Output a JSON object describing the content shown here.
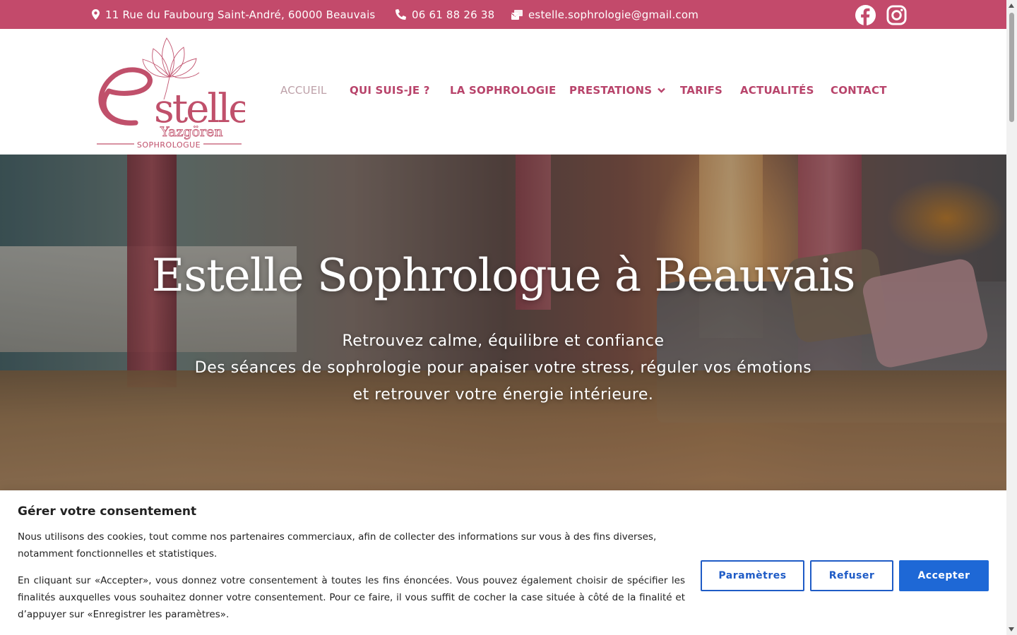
{
  "topbar": {
    "address": "11 Rue du Faubourg Saint-André, 60000 Beauvais",
    "phone": "06 61 88 26 38",
    "email": "estelle.sophrologie@gmail.com",
    "background": "#c34a6b"
  },
  "logo": {
    "name": "Estelle",
    "surname": "Yazgören",
    "tagline": "SOPHROLOGUE"
  },
  "nav": {
    "items": [
      {
        "label": "ACCUEIL",
        "active": true
      },
      {
        "label": "QUI SUIS-JE ?"
      },
      {
        "label": "LA SOPHROLOGIE"
      },
      {
        "label": "PRESTATIONS",
        "has_dropdown": true
      },
      {
        "label": "TARIFS"
      },
      {
        "label": "ACTUALITÉS"
      },
      {
        "label": "CONTACT"
      }
    ],
    "color": "#b8446b"
  },
  "hero": {
    "title": "Estelle Sophrologue à Beauvais",
    "line1": "Retrouvez calme, équilibre et confiance",
    "line2": "Des séances de sophrologie pour apaiser votre stress, réguler vos émotions",
    "line3": "et retrouver votre énergie intérieure."
  },
  "cookie": {
    "title": "Gérer votre consentement",
    "paragraph1": "Nous utilisons des cookies, tout comme nos partenaires commerciaux, afin de collecter des informations sur vous à des fins diverses, notamment fonctionnelles et statistiques.",
    "paragraph2": "En cliquant sur «Accepter», vous donnez votre consentement à toutes les fins énoncées. Vous pouvez également choisir de spécifier les finalités auxquelles vous souhaitez donner votre consentement. Pour ce faire, il vous suffit de cocher la case située à côté de la finalité et d’appuyer sur «Enregistrer les paramètres».",
    "settings_label": "Paramètres",
    "refuse_label": "Refuser",
    "accept_label": "Accepter",
    "accent": "#1e68d6"
  },
  "icons": {
    "location": "map-pin-icon",
    "phone": "phone-icon",
    "email": "email-icon",
    "facebook": "facebook-icon",
    "instagram": "instagram-icon",
    "dropdown": "chevron-down-icon"
  }
}
